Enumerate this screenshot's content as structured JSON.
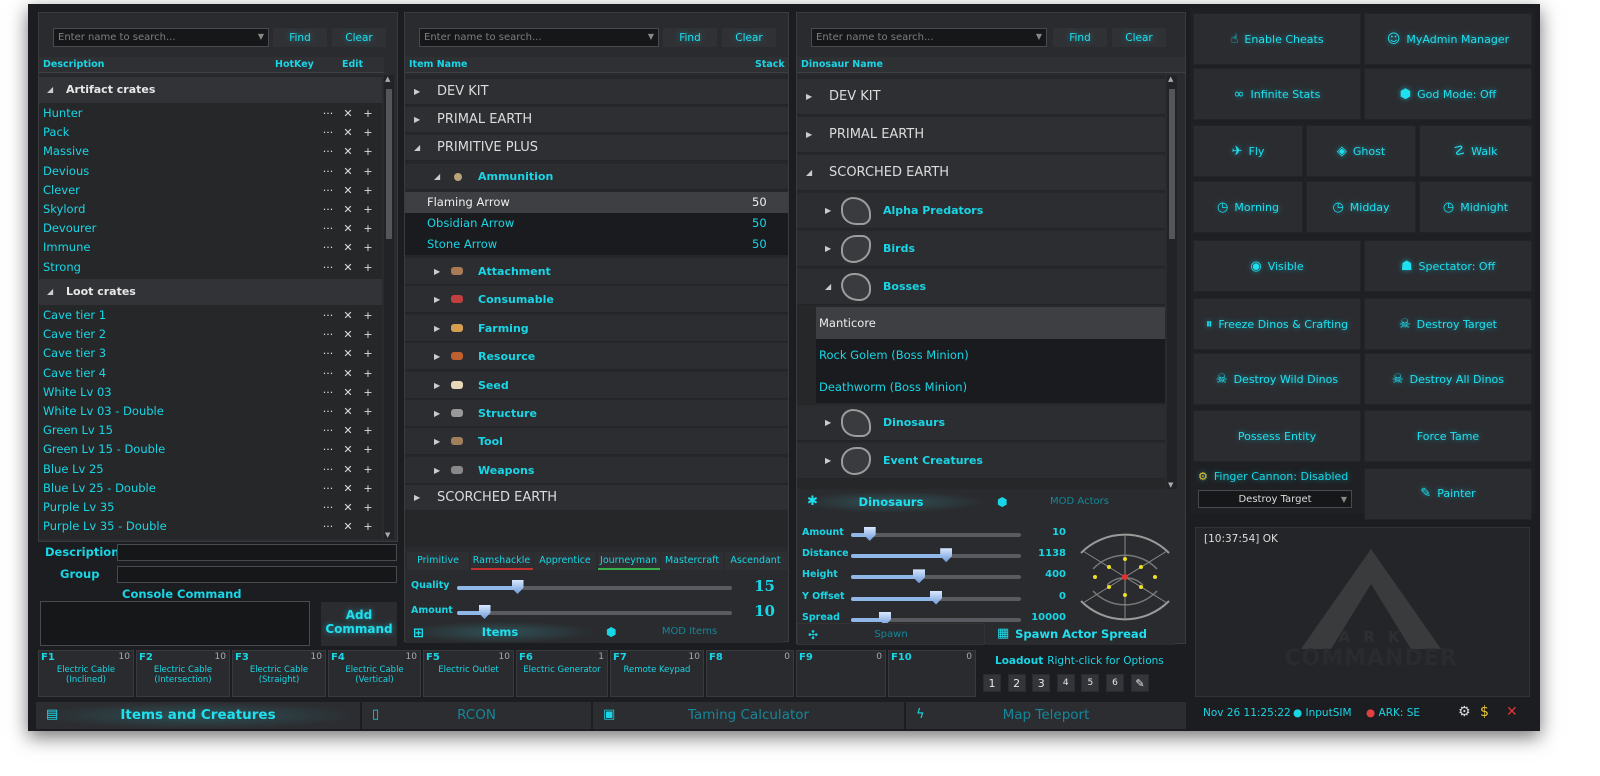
{
  "search": {
    "placeholder": "Enter name to search..."
  },
  "buttons": {
    "find": "Find",
    "clear": "Clear"
  },
  "crates": {
    "columns": [
      "Description",
      "HotKey",
      "Edit"
    ],
    "artifact_group": "Artifact crates",
    "artifact": [
      "Hunter",
      "Pack",
      "Massive",
      "Devious",
      "Clever",
      "Skylord",
      "Devourer",
      "Immune",
      "Strong"
    ],
    "loot_group": "Loot crates",
    "loot": [
      "Cave tier 1",
      "Cave tier 2",
      "Cave tier 3",
      "Cave tier 4",
      "White Lv 03",
      "White Lv 03 - Double",
      "Green Lv 15",
      "Green Lv 15 - Double",
      "Blue Lv 25",
      "Blue Lv 25 - Double",
      "Purple Lv 35",
      "Purple Lv 35 - Double"
    ],
    "actions": {
      "more": "···",
      "remove": "✕",
      "add": "+"
    },
    "description_label": "Description",
    "group_label": "Group",
    "console_label": "Console Command",
    "add_command": "Add Command"
  },
  "items": {
    "columns": [
      "Item Name",
      "Stack"
    ],
    "cat_dev": "DEV KIT",
    "cat_primal": "PRIMAL EARTH",
    "cat_pp": "PRIMITIVE PLUS",
    "cat_se": "SCORCHED EARTH",
    "sub_ammo": "Ammunition",
    "ammo": [
      {
        "name": "Flaming Arrow",
        "stack": "50"
      },
      {
        "name": "Obsidian Arrow",
        "stack": "50"
      },
      {
        "name": "Stone Arrow",
        "stack": "50"
      }
    ],
    "subs": [
      "Attachment",
      "Consumable",
      "Farming",
      "Resource",
      "Seed",
      "Structure",
      "Tool",
      "Weapons"
    ],
    "qualities": [
      "Primitive",
      "Ramshackle",
      "Apprentice",
      "Journeyman",
      "Mastercraft",
      "Ascendant"
    ],
    "quality_label": "Quality",
    "quality_value": "15",
    "quality_level": 0.22,
    "amount_label": "Amount",
    "amount_value": "10",
    "amount_level": 0.1,
    "tab_items": "Items",
    "tab_mod": "MOD Items"
  },
  "dinos": {
    "column": "Dinosaur Name",
    "cat_dev": "DEV KIT",
    "cat_primal": "PRIMAL EARTH",
    "cat_se": "SCORCHED EARTH",
    "sub_alpha": "Alpha Predators",
    "sub_birds": "Birds",
    "sub_bosses": "Bosses",
    "bosses": [
      "Manticore",
      "Rock Golem (Boss Minion)",
      "Deathworm (Boss Minion)"
    ],
    "sub_dinos": "Dinosaurs",
    "sub_event": "Event Creatures",
    "tab_dinos": "Dinosaurs",
    "tab_mod": "MOD Actors",
    "sliders": [
      {
        "label": "Amount",
        "value": "10",
        "level": 0.11
      },
      {
        "label": "Distance",
        "value": "1138",
        "level": 0.56
      },
      {
        "label": "Height",
        "value": "400",
        "level": 0.4
      },
      {
        "label": "Y Offset",
        "value": "0",
        "level": 0.5
      },
      {
        "label": "Spread",
        "value": "10000",
        "level": 0.2
      }
    ],
    "spawn": "Spawn",
    "spawn_spread": "Spawn Actor Spread"
  },
  "cheats": {
    "enable": "Enable Cheats",
    "myadmin": "MyAdmin Manager",
    "infinite": "Infinite Stats",
    "godmode": "God Mode: Off",
    "fly": "Fly",
    "ghost": "Ghost",
    "walk": "Walk",
    "morning": "Morning",
    "midday": "Midday",
    "midnight": "Midnight",
    "visible": "Visible",
    "spectator": "Spectator: Off",
    "freeze": "Freeze Dinos & Crafting",
    "destroy_target": "Destroy Target",
    "destroy_wild": "Destroy Wild Dinos",
    "destroy_all": "Destroy All Dinos",
    "possess": "Possess Entity",
    "force_tame": "Force Tame",
    "finger_cannon": "Finger Cannon: Disabled",
    "finger_select": "Destroy Target",
    "painter": "Painter"
  },
  "log": {
    "line": "[10:37:54] OK",
    "watermark_top": "A R K",
    "watermark": "COMMANDER"
  },
  "status": {
    "datetime": "Nov 26 11:25:22",
    "input": "InputSIM",
    "ark": "ARK: SE",
    "input_color": "#19d6e6",
    "ark_color": "#e04040"
  },
  "hotkeys": [
    {
      "key": "F1",
      "count": "10",
      "desc": "Electric Cable (Inclined)"
    },
    {
      "key": "F2",
      "count": "10",
      "desc": "Electric Cable (Intersection)"
    },
    {
      "key": "F3",
      "count": "10",
      "desc": "Electric Cable (Straight)"
    },
    {
      "key": "F4",
      "count": "10",
      "desc": "Electric Cable (Vertical)"
    },
    {
      "key": "F5",
      "count": "10",
      "desc": "Electric Outlet"
    },
    {
      "key": "F6",
      "count": "1",
      "desc": "Electric Generator"
    },
    {
      "key": "F7",
      "count": "10",
      "desc": "Remote Keypad"
    },
    {
      "key": "F8",
      "count": "0",
      "desc": ""
    },
    {
      "key": "F9",
      "count": "0",
      "desc": ""
    },
    {
      "key": "F10",
      "count": "0",
      "desc": ""
    }
  ],
  "loadout": {
    "label": "Loadout",
    "hint": "Right-click for Options",
    "nums": [
      "1",
      "2",
      "3",
      "4",
      "5",
      "6"
    ]
  },
  "bottom_tabs": [
    "Items and Creatures",
    "RCON",
    "Taming Calculator",
    "Map Teleport"
  ]
}
